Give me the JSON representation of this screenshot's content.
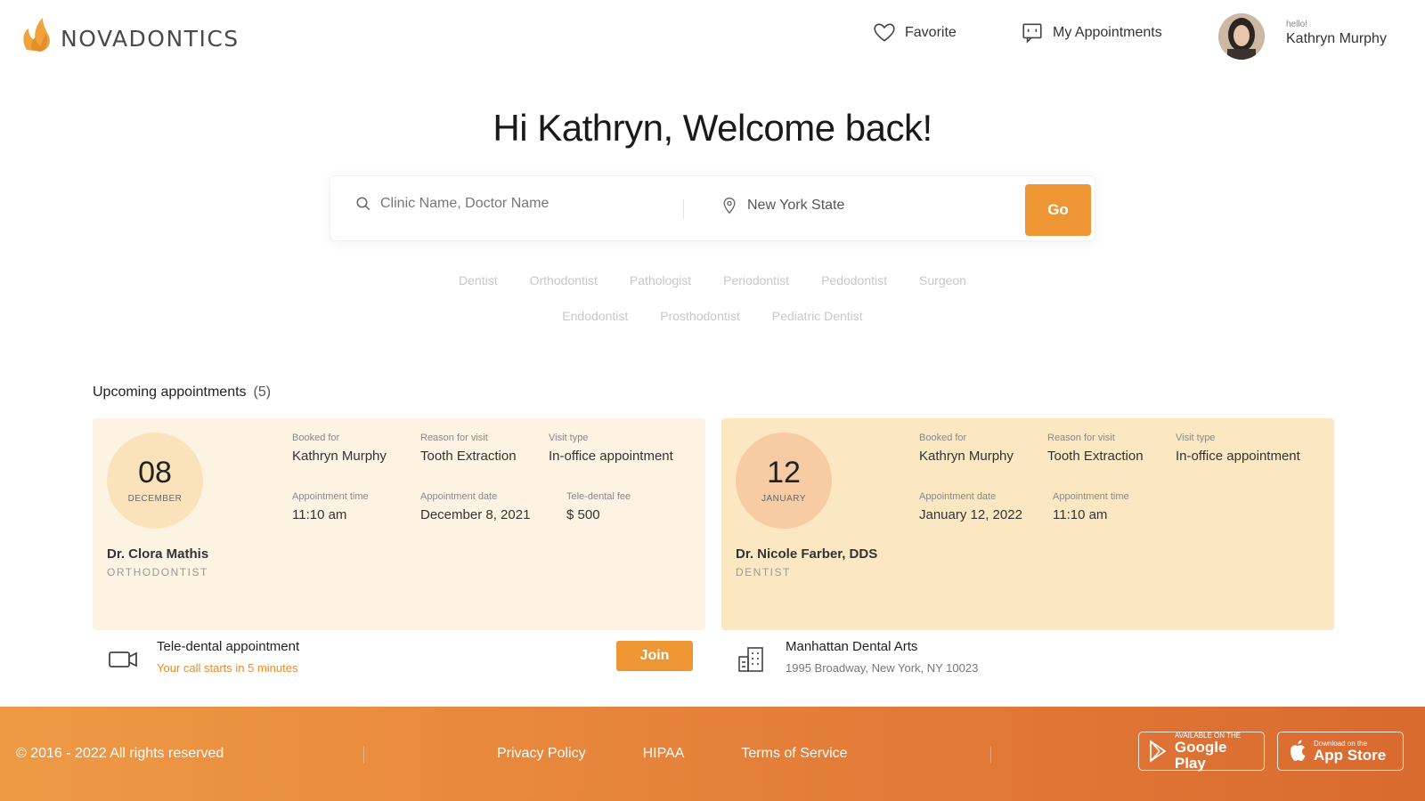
{
  "brand": {
    "name": "NOVADONTICS",
    "colors": {
      "accent": "#ee9633",
      "footer_start": "#ee9a45",
      "footer_end": "#d96a30",
      "card1_bg": "#fcf3e3",
      "card2_bg": "#fce7c3"
    }
  },
  "nav": {
    "favorite": "Favorite",
    "my_appointments": "My Appointments"
  },
  "user": {
    "greeting": "hello!",
    "name": "Kathryn Murphy"
  },
  "welcome": "Hi Kathryn, Welcome back!",
  "search": {
    "name_placeholder": "Clinic Name, Doctor Name",
    "location_value": "New York State",
    "go_label": "Go"
  },
  "specialties_row1": [
    "Dentist",
    "Orthodontist",
    "Pathologist",
    "Periodontist",
    "Pedodontist",
    "Surgeon"
  ],
  "specialties_row2": [
    "Endodontist",
    "Prosthodontist",
    "Pediatric Dentist"
  ],
  "upcoming": {
    "title": "Upcoming appointments",
    "count": "(5)"
  },
  "appointments": [
    {
      "day": "08",
      "month": "DECEMBER",
      "doctor": "Dr. Clora Mathis",
      "specialty": "ORTHODONTIST",
      "booked_for_label": "Booked for",
      "booked_for": "Kathryn Murphy",
      "reason_label": "Reason for visit",
      "reason": "Tooth Extraction",
      "visit_type_label": "Visit type",
      "visit_type": "In-office appointment",
      "time_label": "Appointment time",
      "time": "11:10 am",
      "date_label": "Appointment date",
      "date": "December 8, 2021",
      "fee_label": "Tele-dental fee",
      "fee": "$ 500",
      "footer_title": "Tele-dental appointment",
      "footer_sub": "Your call starts in 5 minutes",
      "join_label": "Join",
      "footer_icon": "video-camera-icon"
    },
    {
      "day": "12",
      "month": "JANUARY",
      "doctor": "Dr. Nicole Farber, DDS",
      "specialty": "DENTIST",
      "booked_for_label": "Booked for",
      "booked_for": "Kathryn Murphy",
      "reason_label": "Reason for visit",
      "reason": "Tooth Extraction",
      "visit_type_label": "Visit type",
      "visit_type": "In-office appointment",
      "date_label": "Appointment date",
      "date": "January 12, 2022",
      "time_label": "Appointment time",
      "time": "11:10 am",
      "footer_title": "Manhattan Dental Arts",
      "footer_sub": "1995 Broadway, New York, NY 10023",
      "footer_icon": "building-icon"
    }
  ],
  "footer": {
    "copyright": "© 2016 - 2022 All rights reserved",
    "links": [
      "Privacy Policy",
      "HIPAA",
      "Terms of Service"
    ],
    "google_small": "AVAILABLE ON THE",
    "google_big": "Google Play",
    "apple_small": "Download on the",
    "apple_big": "App Store"
  }
}
